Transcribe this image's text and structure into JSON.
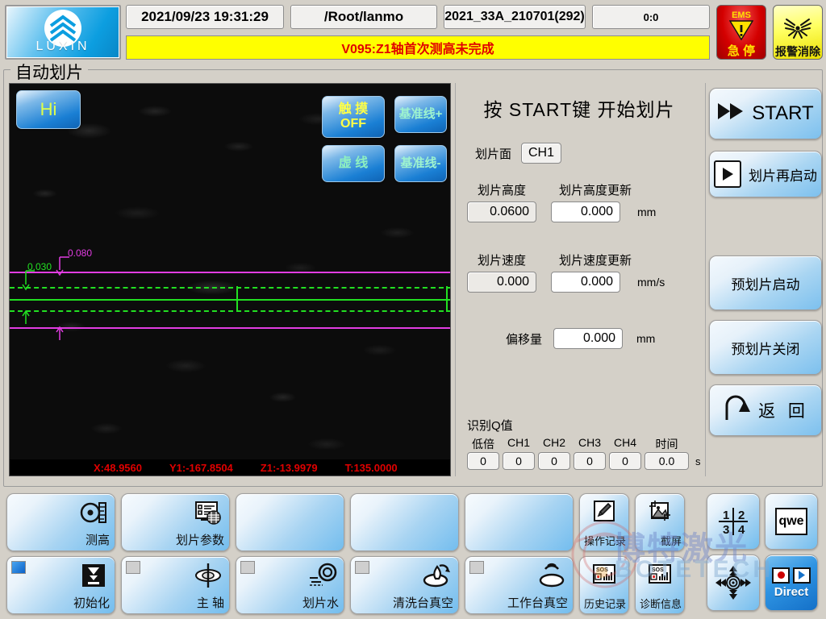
{
  "header": {
    "logo_text": "LUXIN",
    "datetime": "2021/09/23 19:31:29",
    "path": "/Root/lanmo",
    "recipe": "2021_33A_210701(292)",
    "counter": "0:0",
    "alarm_message": "V095:Z1轴首次测高未完成",
    "alarm_color": "#e00000",
    "alarm_bg": "#ffff00",
    "ems_top_label": "EMS",
    "ems_label": "急 停",
    "alarm_clear_label": "报警消除"
  },
  "group": {
    "title": "自动划片"
  },
  "camera": {
    "overlay_buttons": {
      "hi": "Hi",
      "touch_line1": "触 摸",
      "touch_line2": "OFF",
      "dashed": "虚 线",
      "ref_plus": "基准线+",
      "ref_minus": "基准线-"
    },
    "annotations": {
      "magenta_value": "0.080",
      "green_value": "0.030"
    },
    "coordinates": [
      {
        "label": "X:48.9560"
      },
      {
        "label": "Y1:-167.8504"
      },
      {
        "label": "Z1:-13.9979"
      },
      {
        "label": "T:135.0000"
      }
    ]
  },
  "center": {
    "title": "按 START键 开始划片",
    "face_label": "划片面",
    "face_value": "CH1",
    "params": [
      {
        "label_current": "划片高度",
        "label_update": "划片高度更新",
        "value_current": "0.0600",
        "value_update": "0.000",
        "unit": "mm"
      },
      {
        "label_current": "划片速度",
        "label_update": "划片速度更新",
        "value_current": "0.000",
        "value_update": "0.000",
        "unit": "mm/s"
      }
    ],
    "offset": {
      "label": "偏移量",
      "value": "0.000",
      "unit": "mm"
    },
    "qvalue": {
      "title": "识别Q值",
      "headers": [
        "低倍",
        "CH1",
        "CH2",
        "CH3",
        "CH4",
        "时间"
      ],
      "values": [
        "0",
        "0",
        "0",
        "0",
        "0",
        "0.0"
      ],
      "unit": "s"
    }
  },
  "sidebar": {
    "start": "START",
    "restart": "划片再启动",
    "pre_start": "预划片启动",
    "pre_stop": "预划片关闭",
    "back": "返 回"
  },
  "toolbar": {
    "row1": [
      {
        "label": "测高",
        "icon": "height-gauge-icon"
      },
      {
        "label": "划片参数",
        "icon": "parameter-list-icon"
      },
      {
        "label": "",
        "icon": ""
      },
      {
        "label": "",
        "icon": ""
      },
      {
        "label": "",
        "icon": ""
      }
    ],
    "row1_small": [
      {
        "label": "操作记录",
        "icon": "pencil-icon"
      },
      {
        "label": "截屏",
        "icon": "screenshot-icon"
      }
    ],
    "row2": [
      {
        "label": "初始化",
        "icon": "init-arrow-icon",
        "status": "on"
      },
      {
        "label": "主 轴",
        "icon": "spindle-icon",
        "status": "off"
      },
      {
        "label": "划片水",
        "icon": "water-icon",
        "status": "off"
      },
      {
        "label": "清洗台真空",
        "icon": "clean-vacuum-icon",
        "status": "off"
      },
      {
        "label": "工作台真空",
        "icon": "table-vacuum-icon",
        "status": "off"
      }
    ],
    "row2_small": [
      {
        "label": "历史记录",
        "icon": "sos-chart-icon"
      },
      {
        "label": "诊断信息",
        "icon": "sos-chart-icon"
      }
    ],
    "corner": {
      "numpad": [
        "1",
        "2",
        "3",
        "4"
      ],
      "keyboard": "qwe",
      "jog": "dpad-icon",
      "direct": "Direct"
    }
  },
  "watermark": {
    "cn": "博特激光",
    "en": "BOTETECH"
  }
}
